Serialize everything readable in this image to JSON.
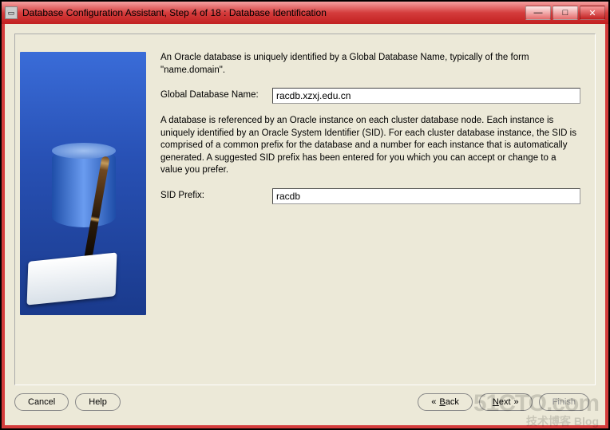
{
  "window": {
    "title": "Database Configuration Assistant, Step 4 of 18 : Database Identification"
  },
  "content": {
    "intro": "An Oracle database is uniquely identified by a Global Database Name, typically of the form \"name.domain\".",
    "gdn_label": "Global Database Name:",
    "gdn_value": "racdb.xzxj.edu.cn",
    "sid_desc": "A database is referenced by an Oracle instance on each cluster database node. Each instance is uniquely identified by an Oracle System Identifier (SID). For each cluster database instance, the SID is comprised of a common prefix for the database and a number for each instance that is automatically generated. A suggested SID prefix has been entered for you which you can accept or change to a value you prefer.",
    "sid_label": "SID Prefix:",
    "sid_value": "racdb"
  },
  "buttons": {
    "cancel": "Cancel",
    "help": "Help",
    "back": "Back",
    "next": "Next",
    "finish": "Finish"
  },
  "watermark": {
    "line1": "51CTO.com",
    "line2": "技术博客      Blog"
  }
}
